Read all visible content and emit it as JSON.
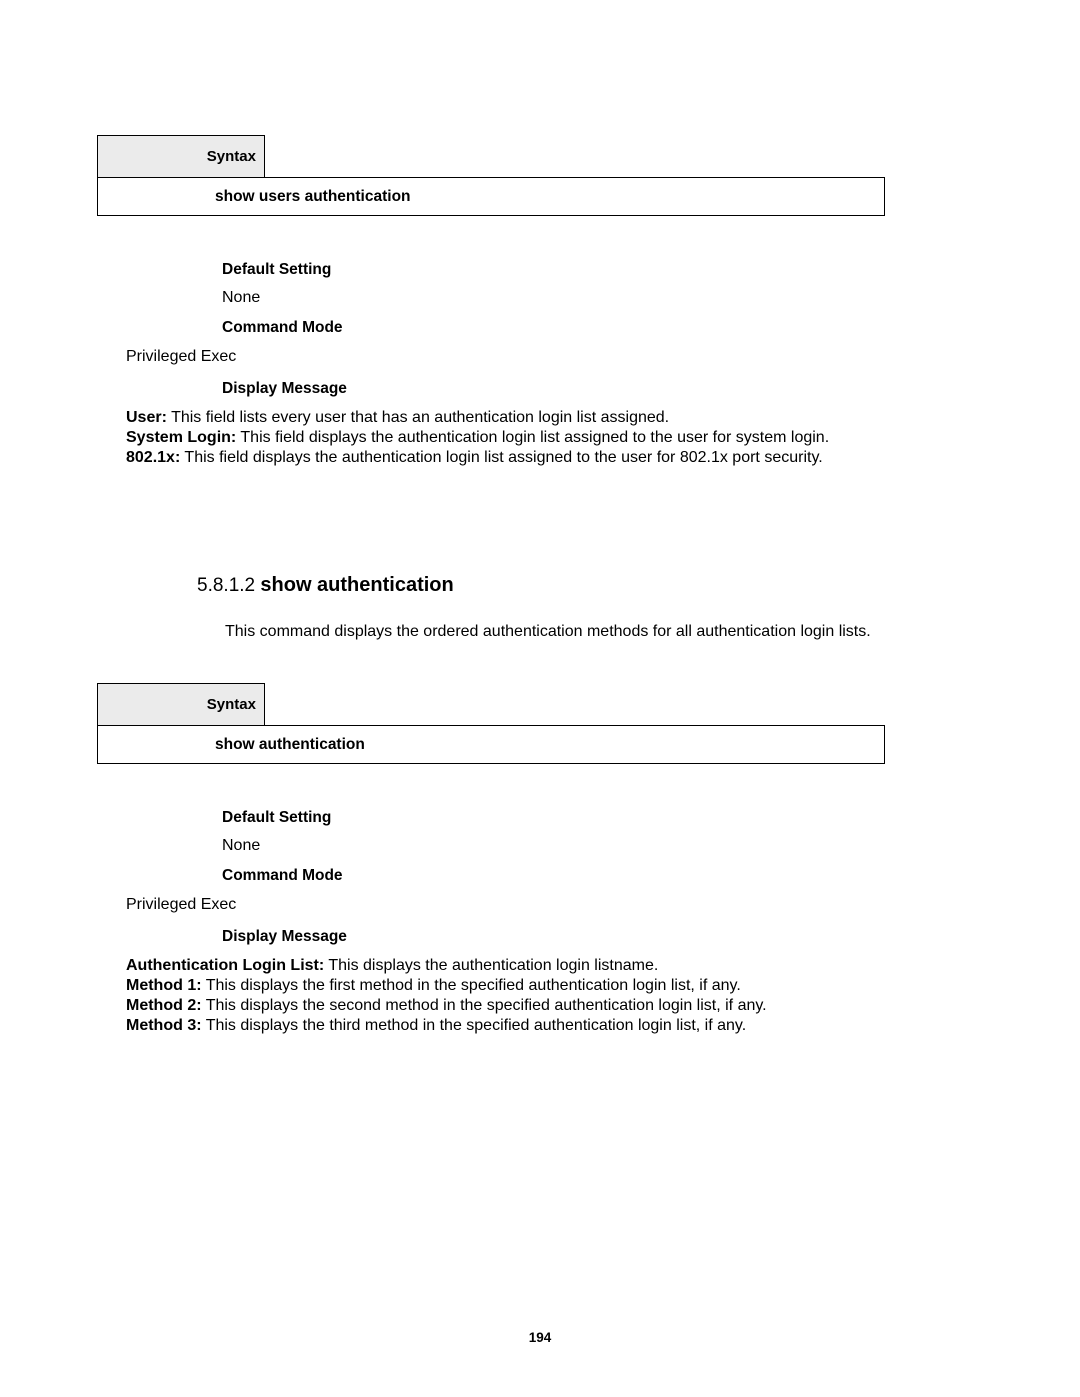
{
  "section1": {
    "syntaxLabel": "Syntax",
    "command": "show users authentication",
    "defaultSetting": {
      "heading": "Default Setting",
      "value": "None"
    },
    "commandMode": {
      "heading": "Command Mode",
      "value": "Privileged Exec"
    },
    "displayMessage": {
      "heading": "Display Message",
      "items": [
        {
          "label": "User:",
          "text": " This field lists every user that has an authentication login list assigned."
        },
        {
          "label": "System Login:",
          "text": " This field displays the authentication login list assigned to the user for system login."
        },
        {
          "label": "802.1x:",
          "text": " This field displays the authentication login list assigned to the user for 802.1x port security."
        }
      ]
    }
  },
  "section2": {
    "number": "5.8.1.2 ",
    "name": "show authentication",
    "description": "This command displays the ordered authentication methods for all authentication login lists.",
    "syntaxLabel": "Syntax",
    "command": "show authentication",
    "defaultSetting": {
      "heading": "Default Setting",
      "value": "None"
    },
    "commandMode": {
      "heading": "Command Mode",
      "value": "Privileged Exec"
    },
    "displayMessage": {
      "heading": "Display Message",
      "items": [
        {
          "label": "Authentication Login List:",
          "text": " This displays the authentication login listname."
        },
        {
          "label": "Method 1:",
          "text": " This displays the first method in the specified authentication login list, if any."
        },
        {
          "label": "Method 2:",
          "text": " This displays the second method in the specified authentication login list, if any."
        },
        {
          "label": "Method 3:",
          "text": " This displays the third method in the specified authentication login list, if any."
        }
      ]
    }
  },
  "pageNumber": "194"
}
